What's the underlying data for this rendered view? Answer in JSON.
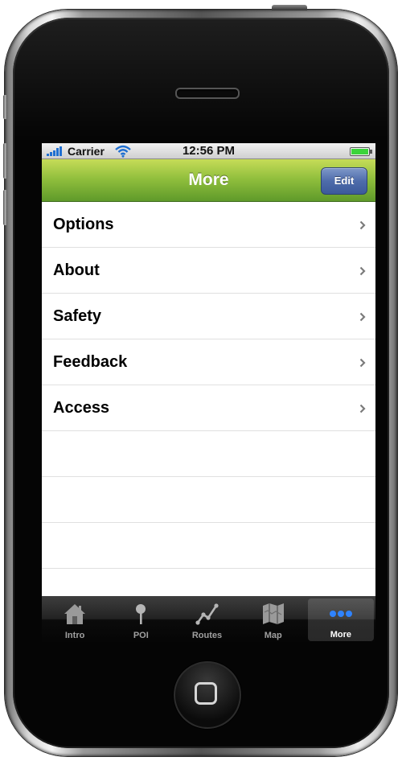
{
  "status_bar": {
    "carrier": "Carrier",
    "time": "12:56 PM"
  },
  "nav_bar": {
    "title": "More",
    "edit_label": "Edit"
  },
  "menu": {
    "items": [
      {
        "label": "Options"
      },
      {
        "label": "About"
      },
      {
        "label": "Safety"
      },
      {
        "label": "Feedback"
      },
      {
        "label": "Access"
      }
    ]
  },
  "tab_bar": {
    "selected": "More",
    "tabs": [
      {
        "label": "Intro",
        "icon": "house-icon"
      },
      {
        "label": "POI",
        "icon": "pin-icon"
      },
      {
        "label": "Routes",
        "icon": "route-icon"
      },
      {
        "label": "Map",
        "icon": "map-icon"
      },
      {
        "label": "More",
        "icon": "more-dots-icon"
      }
    ]
  },
  "colors": {
    "nav_bar_green": "#8fbe3c",
    "edit_button_blue": "#4e6cab",
    "tab_bar_black": "#0b0b0b",
    "selected_more_blue": "#2f83ff"
  }
}
